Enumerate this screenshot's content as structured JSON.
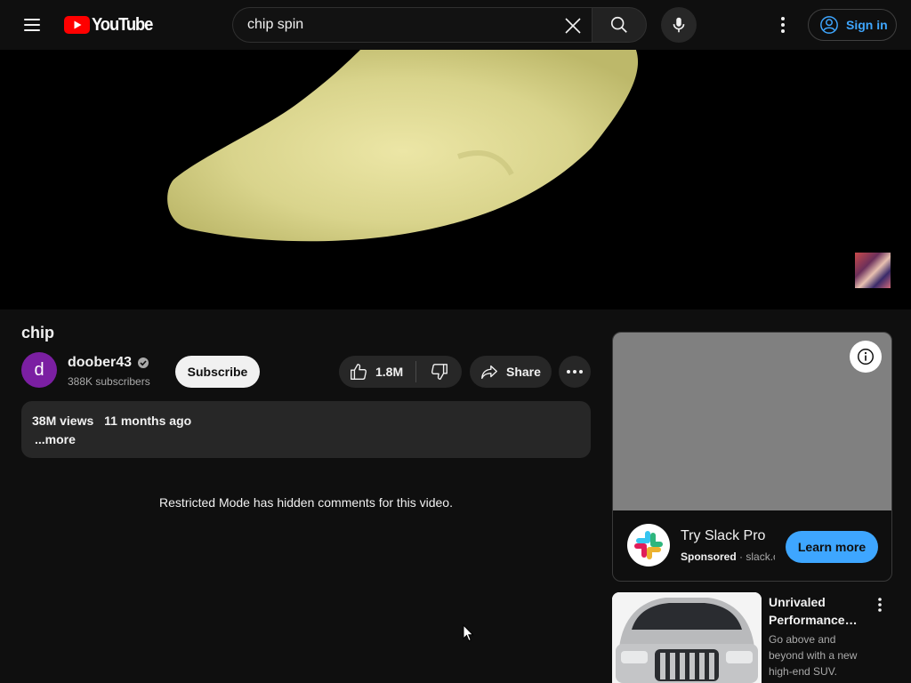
{
  "header": {
    "logo_text": "YouTube",
    "search_value": "chip spin",
    "search_placeholder": "Search",
    "signin_label": "Sign in"
  },
  "video": {
    "title": "chip"
  },
  "channel": {
    "avatar_letter": "d",
    "name": "doober43",
    "subscribers": "388K subscribers",
    "subscribe_label": "Subscribe"
  },
  "actions": {
    "like_count": "1.8M",
    "share_label": "Share"
  },
  "description": {
    "views": "38M views",
    "age": "11 months ago",
    "more_label": "...more"
  },
  "comments": {
    "restricted_message": "Restricted Mode has hidden comments for this video."
  },
  "ad": {
    "title": "Try Slack Pro",
    "sponsored_label": "Sponsored",
    "domain": "slack.com",
    "cta_label": "Learn more"
  },
  "sponsored_rec": {
    "title": "Unrivaled Performance…",
    "description": "Go above and beyond with a new high-end SUV."
  },
  "colors": {
    "background": "#0f0f0f",
    "accent_blue": "#3ea6ff",
    "brand_red": "#ff0000",
    "avatar_purple": "#7b1fa2"
  }
}
